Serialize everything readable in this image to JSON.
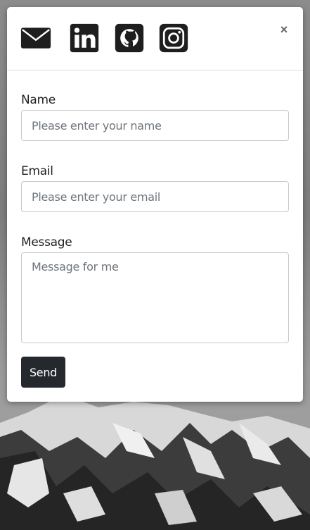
{
  "header": {
    "social_icons": [
      "envelope-icon",
      "linkedin-icon",
      "github-icon",
      "instagram-icon"
    ],
    "close_label": "×"
  },
  "form": {
    "name": {
      "label": "Name",
      "placeholder": "Please enter your name"
    },
    "email": {
      "label": "Email",
      "placeholder": "Please enter your email"
    },
    "message": {
      "label": "Message",
      "placeholder": "Message for me"
    },
    "send_label": "Send"
  },
  "colors": {
    "button_bg": "#25282c",
    "icon_color": "#1e1e1e",
    "modal_bg": "#ffffff"
  }
}
